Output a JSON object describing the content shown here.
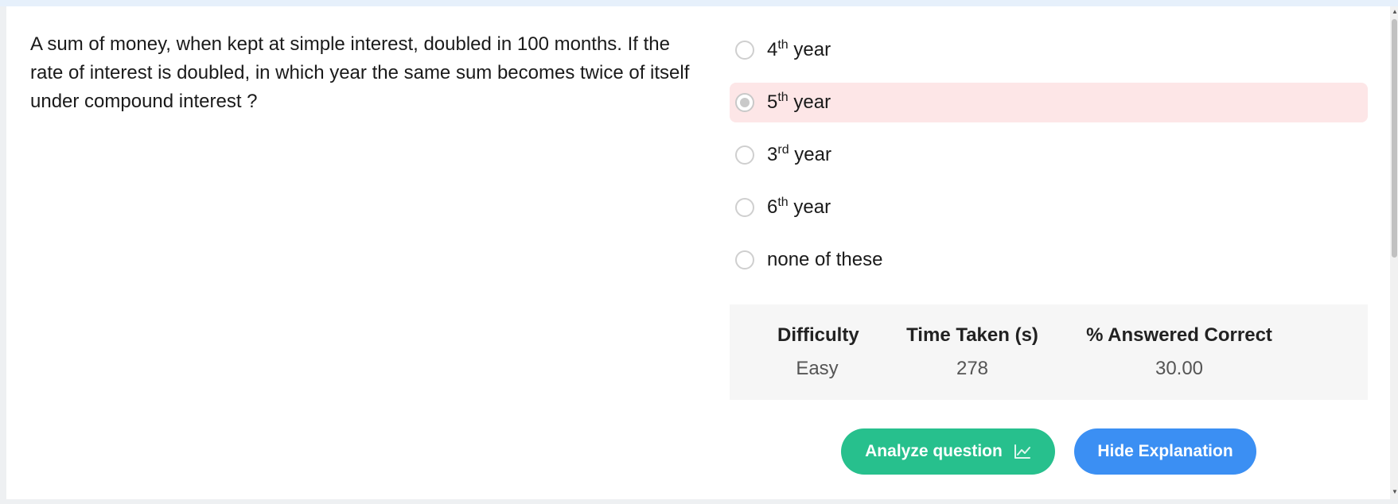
{
  "question": {
    "text": "A sum of money, when kept at simple interest, doubled in 100 months. If the rate of interest is doubled, in which year the same sum becomes twice of itself under compound interest ?"
  },
  "options": [
    {
      "num": "4",
      "sup": "th",
      "rest": " year",
      "selected": false
    },
    {
      "num": "5",
      "sup": "th",
      "rest": " year",
      "selected": true
    },
    {
      "num": "3",
      "sup": "rd",
      "rest": " year",
      "selected": false
    },
    {
      "num": "6",
      "sup": "th",
      "rest": " year",
      "selected": false
    },
    {
      "num": "none of these",
      "sup": "",
      "rest": "",
      "selected": false
    }
  ],
  "stats": {
    "difficulty_label": "Difficulty",
    "difficulty_value": "Easy",
    "time_label": "Time Taken (s)",
    "time_value": "278",
    "correct_label": "% Answered Correct",
    "correct_value": "30.00"
  },
  "buttons": {
    "analyze_label": "Analyze question",
    "analyze_icon": "chart-line-icon",
    "hide_label": "Hide Explanation"
  },
  "colors": {
    "selected_bg": "#fde6e7",
    "analyze_bg": "#27c08d",
    "hide_bg": "#3b8ff3"
  }
}
